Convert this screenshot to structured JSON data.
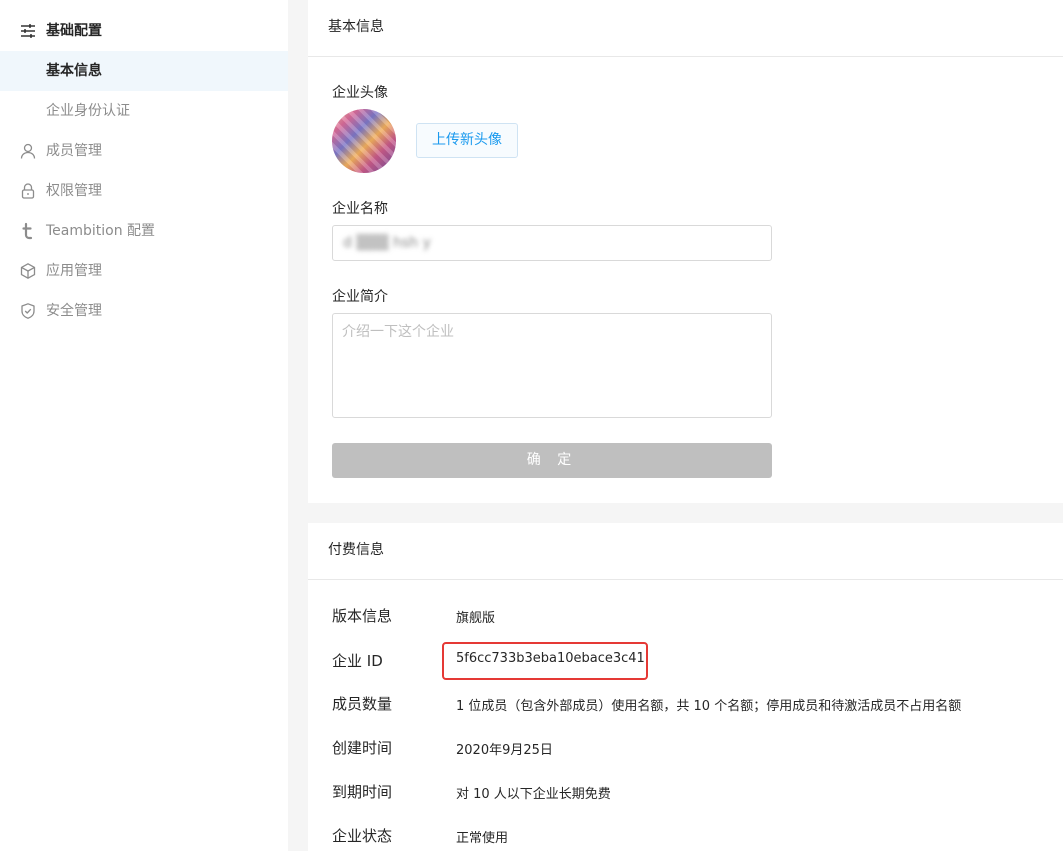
{
  "sidebar": {
    "items": [
      {
        "label": "基础配置"
      },
      {
        "label": "基本信息"
      },
      {
        "label": "企业身份认证"
      },
      {
        "label": "成员管理"
      },
      {
        "label": "权限管理"
      },
      {
        "label": "Teambition 配置"
      },
      {
        "label": "应用管理"
      },
      {
        "label": "安全管理"
      }
    ]
  },
  "basic": {
    "title": "基本信息",
    "avatar_label": "企业头像",
    "upload_label": "上传新头像",
    "name_label": "企业名称",
    "name_value": "d ▒▒▒ hsh y",
    "intro_label": "企业简介",
    "intro_placeholder": "介绍一下这个企业",
    "confirm_label": "确 定"
  },
  "pay": {
    "title": "付费信息",
    "rows": [
      {
        "key": "版本信息",
        "value": "旗舰版"
      },
      {
        "key": "企业 ID",
        "value": "5f6cc733b3eba10ebace3c41"
      },
      {
        "key": "成员数量",
        "value": "1 位成员（包含外部成员）使用名额，共 10 个名额；停用成员和待激活成员不占用名额"
      },
      {
        "key": "创建时间",
        "value": "2020年9月25日"
      },
      {
        "key": "到期时间",
        "value": "对 10 人以下企业长期免费"
      },
      {
        "key": "企业状态",
        "value": "正常使用"
      }
    ]
  },
  "colors": {
    "accent": "#1b9aee",
    "active_bg": "#f0f7fc",
    "highlight": "#e53935",
    "disabled_button": "#bfbfbf"
  }
}
